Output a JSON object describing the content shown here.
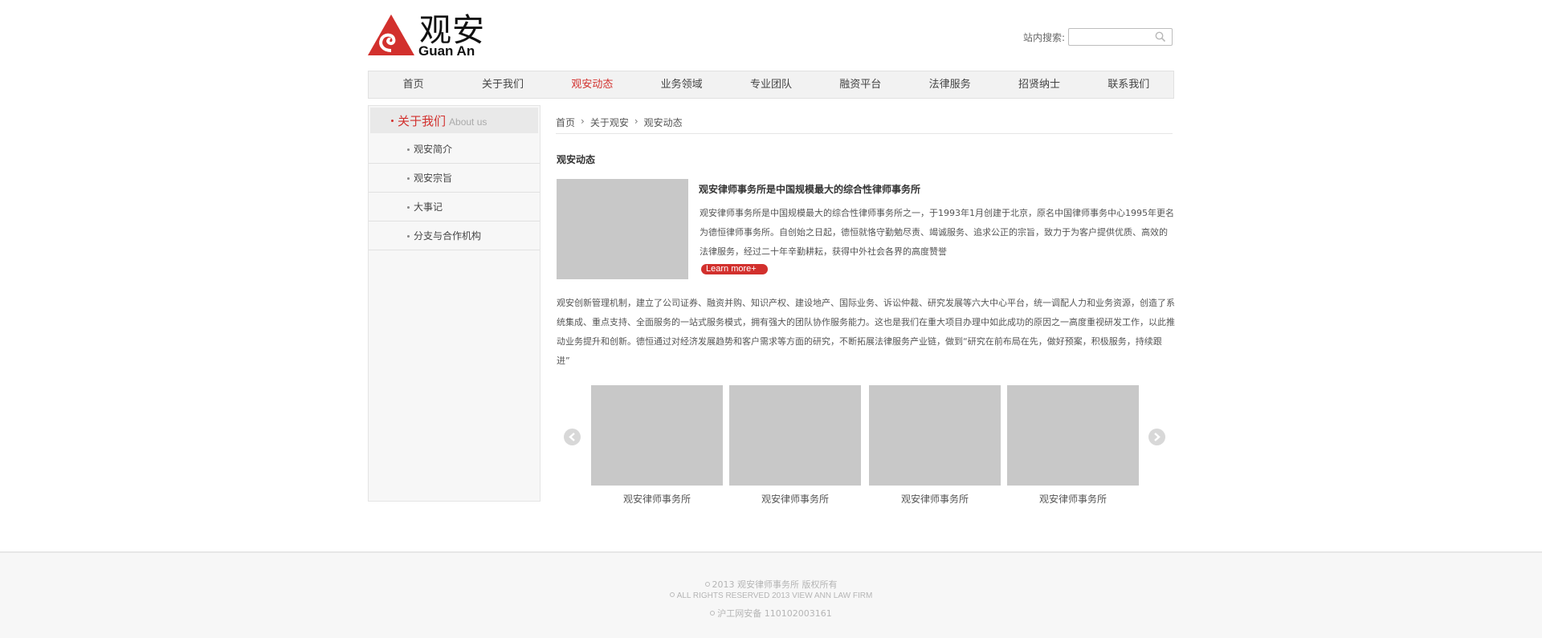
{
  "header": {
    "logo_cn": "观安",
    "logo_en": "Guan An",
    "search_label": "站内搜索:",
    "search_value": ""
  },
  "nav": {
    "items": [
      {
        "label": "首页"
      },
      {
        "label": "关于我们"
      },
      {
        "label": "观安动态"
      },
      {
        "label": "业务领域"
      },
      {
        "label": "专业团队"
      },
      {
        "label": "融资平台"
      },
      {
        "label": "法律服务"
      },
      {
        "label": "招贤纳士"
      },
      {
        "label": "联系我们"
      }
    ],
    "active_index": 2
  },
  "sidebar": {
    "title": "关于我们",
    "title_en": "About us",
    "items": [
      {
        "label": "观安简介"
      },
      {
        "label": "观安宗旨"
      },
      {
        "label": "大事记"
      },
      {
        "label": "分支与合作机构"
      }
    ]
  },
  "breadcrumb": {
    "items": [
      "首页",
      "关于观安",
      "观安动态"
    ]
  },
  "main": {
    "section_title": "观安动态",
    "feature": {
      "title": "观安律师事务所是中国规模最大的综合性律师事务所",
      "text": "观安律师事务所是中国规模最大的综合性律师事务所之一，于1993年1月创建于北京，原名中国律师事务中心1995年更名为德恒律师事务所。自创始之日起，德恒就恪守勤勉尽责、竭诚服务、追求公正的宗旨，致力于为客户提供优质、高效的法律服务，经过二十年辛勤耕耘，获得中外社会各界的高度赞誉",
      "more_label": "Learn more+"
    },
    "body": "观安创新管理机制，建立了公司证券、融资并购、知识产权、建设地产、国际业务、诉讼仲裁、研究发展等六大中心平台，统一调配人力和业务资源，创造了系统集成、重点支持、全面服务的一站式服务模式，拥有强大的团队协作服务能力。这也是我们在重大项目办理中如此成功的原因之一高度重视研发工作，以此推动业务提升和创新。德恒通过对经济发展趋势和客户需求等方面的研究，不断拓展法律服务产业链，做到“研究在前布局在先，做好预案，积极服务，持续跟进”",
    "gallery": [
      {
        "caption": "观安律师事务所"
      },
      {
        "caption": "观安律师事务所"
      },
      {
        "caption": "观安律师事务所"
      },
      {
        "caption": "观安律师事务所"
      }
    ]
  },
  "footer": {
    "copyright": "2013  观安律师事务所  版权所有",
    "rights": "ALL RIGHTS RESERVED 2013 VIEW ANN LAW FIRM",
    "icp": "沪工网安备  110102003161"
  },
  "colors": {
    "accent": "#d2302d",
    "placeholder_gray": "#c8c8c8"
  }
}
